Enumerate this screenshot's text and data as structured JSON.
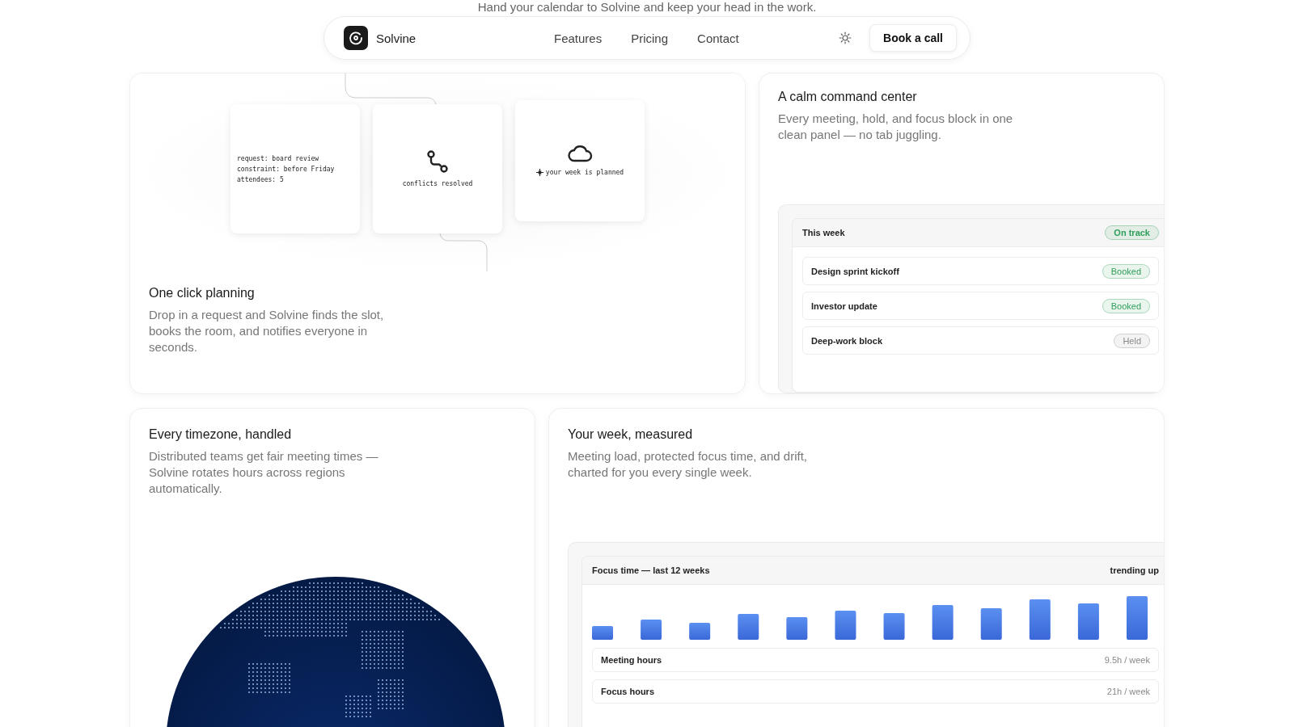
{
  "tagline": "Hand your calendar to Solvine and keep your head in the work.",
  "nav": {
    "brand": "Solvine",
    "links": [
      "Features",
      "Pricing",
      "Contact"
    ],
    "cta": "Book a call"
  },
  "planning": {
    "title": "One click planning",
    "description": "Drop in a request and Solvine finds the slot, books the room, and notifies everyone in seconds.",
    "steps": [
      {
        "kind": "code",
        "lines": [
          "request: board review",
          "constraint: before Friday",
          "attendees: 5"
        ]
      },
      {
        "kind": "route",
        "caption": "conflicts resolved"
      },
      {
        "kind": "cloud",
        "caption": "your week is planned"
      }
    ]
  },
  "command": {
    "title": "A calm command center",
    "description": "Every meeting, hold, and focus block in one clean panel — no tab juggling.",
    "panel": {
      "title": "This week",
      "status": {
        "label": "On track",
        "color": "#2f9e5a"
      },
      "items": [
        {
          "name": "Design sprint kickoff",
          "status": "Booked",
          "color": "#2f9e5a"
        },
        {
          "name": "Investor update",
          "status": "Booked",
          "color": "#2f9e5a"
        },
        {
          "name": "Deep-work block",
          "status": "Held",
          "color": "#8a8a8a"
        }
      ]
    }
  },
  "timezone": {
    "title": "Every timezone, handled",
    "description": "Distributed teams get fair meeting times — Solvine rotates hours across regions automatically."
  },
  "measured": {
    "title": "Your week, measured",
    "description": "Meeting load, protected focus time, and drift, charted for you every single week.",
    "chart": {
      "title": "Focus time — last 12 weeks",
      "trend": "trending up"
    },
    "metrics": [
      {
        "label": "Meeting hours",
        "value": "9.5h / week"
      },
      {
        "label": "Focus hours",
        "value": "21h / week"
      }
    ]
  }
}
